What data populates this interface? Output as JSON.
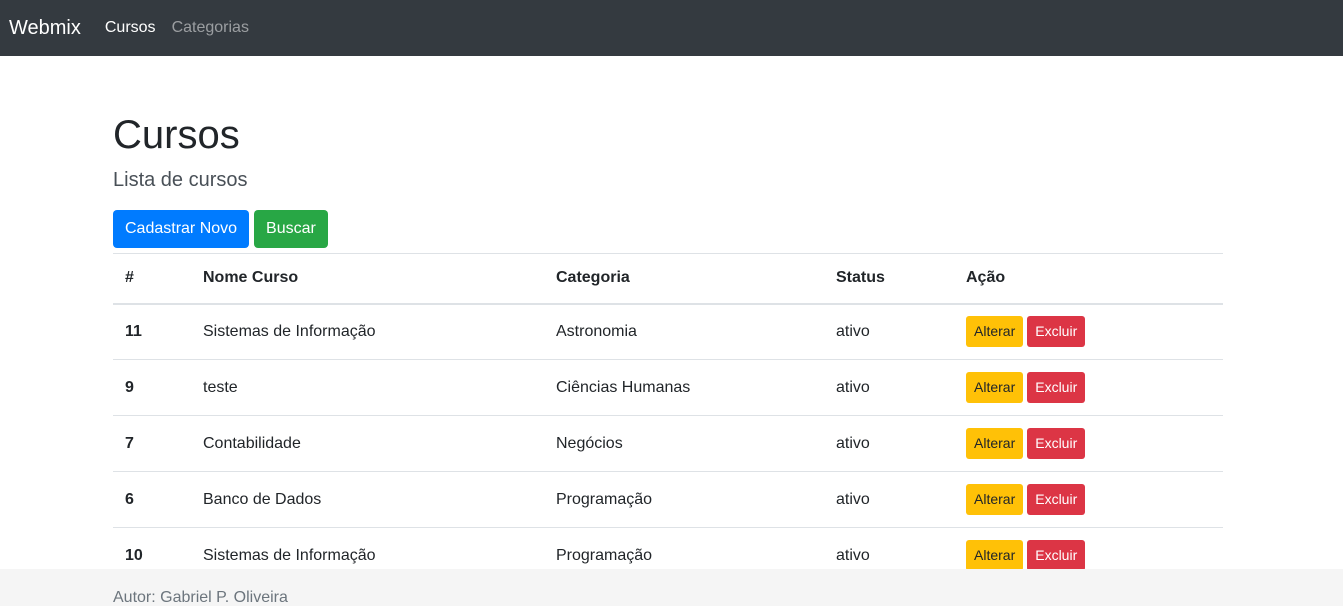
{
  "navbar": {
    "brand": "Webmix",
    "links": [
      {
        "label": "Cursos"
      },
      {
        "label": "Categorias"
      }
    ]
  },
  "page": {
    "title": "Cursos",
    "subtitle": "Lista de cursos"
  },
  "actions": {
    "new_label": "Cadastrar Novo",
    "search_label": "Buscar"
  },
  "table": {
    "headers": [
      "#",
      "Nome Curso",
      "Categoria",
      "Status",
      "Ação"
    ],
    "rows": [
      {
        "id": "11",
        "name": "Sistemas de Informação",
        "category": "Astronomia",
        "status": "ativo"
      },
      {
        "id": "9",
        "name": "teste",
        "category": "Ciências Humanas",
        "status": "ativo"
      },
      {
        "id": "7",
        "name": "Contabilidade",
        "category": "Negócios",
        "status": "ativo"
      },
      {
        "id": "6",
        "name": "Banco de Dados",
        "category": "Programação",
        "status": "ativo"
      },
      {
        "id": "10",
        "name": "Sistemas de Informação",
        "category": "Programação",
        "status": "ativo"
      }
    ],
    "row_actions": {
      "edit_label": "Alterar",
      "delete_label": "Excluir"
    }
  },
  "footer": {
    "text": "Autor: Gabriel P. Oliveira"
  },
  "colors": {
    "navbar_bg": "#343a40",
    "primary": "#007bff",
    "success": "#28a745",
    "warning": "#ffc107",
    "danger": "#dc3545",
    "footer_bg": "#f5f5f5"
  }
}
